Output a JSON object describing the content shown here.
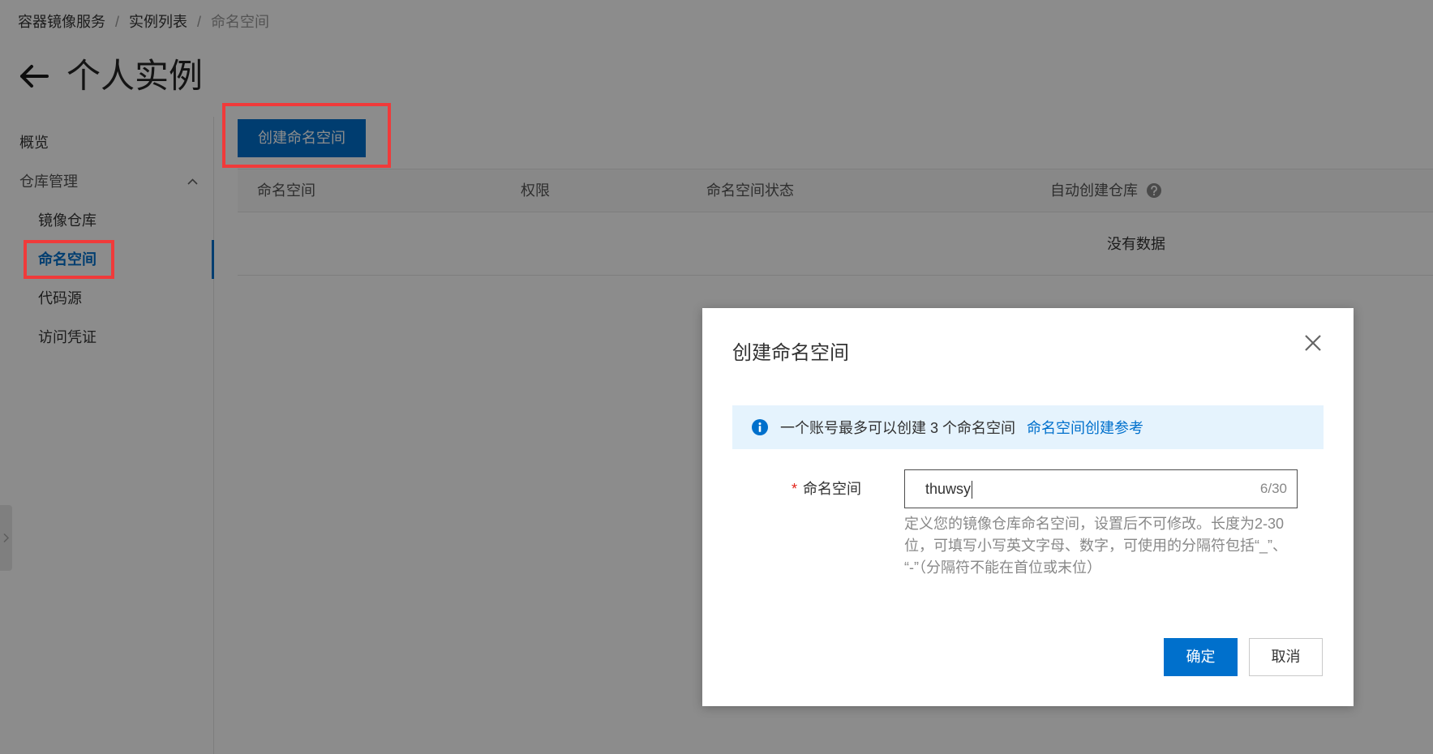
{
  "breadcrumb": {
    "items": [
      "容器镜像服务",
      "实例列表",
      "命名空间"
    ],
    "separator": "/"
  },
  "page": {
    "title": "个人实例"
  },
  "sidebar": {
    "overview": "概览",
    "group": {
      "label": "仓库管理",
      "expanded": true,
      "items": [
        "镜像仓库",
        "命名空间",
        "代码源",
        "访问凭证"
      ],
      "active": "命名空间"
    }
  },
  "toolbar": {
    "create_label": "创建命名空间"
  },
  "table": {
    "columns": [
      "命名空间",
      "权限",
      "命名空间状态",
      "自动创建仓库"
    ],
    "empty_text": "没有数据"
  },
  "modal": {
    "title": "创建命名空间",
    "alert": {
      "text": "一个账号最多可以创建 3 个命名空间",
      "link": "命名空间创建参考"
    },
    "field": {
      "required_mark": "*",
      "label": "命名空间",
      "value": "thuwsy",
      "counter": "6/30",
      "help": [
        "定义您的镜像仓库命名空间，设置后不可修改。长度为2-30",
        "位，可填写小写英文字母、数字，可使用的分隔符包括“_”、",
        "“-”（分隔符不能在首位或末位）"
      ]
    },
    "confirm_label": "确定",
    "cancel_label": "取消"
  },
  "icons": {
    "back": "arrow-left-icon",
    "group_toggle": "chevron-up-icon",
    "column_help": "question-circle-icon",
    "alert": "info-circle-icon",
    "close": "close-icon",
    "edge_handle": "chevron-right-icon"
  },
  "colors": {
    "accent": "#0070cc",
    "annotation": "#f03a3a",
    "required": "#e2231a",
    "alert_background": "#e5f3fd"
  }
}
